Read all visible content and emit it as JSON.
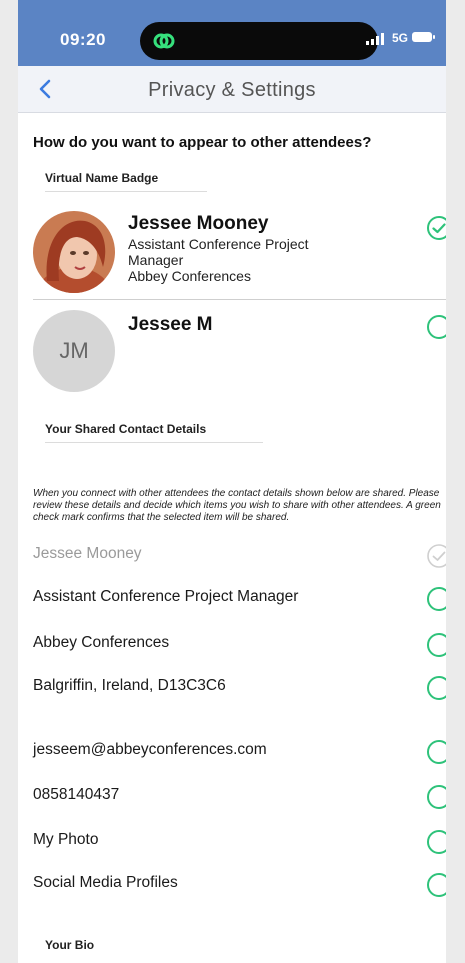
{
  "status_bar": {
    "time": "09:20",
    "network": "5G"
  },
  "nav": {
    "title": "Privacy & Settings",
    "back_icon": "chevron-left-icon"
  },
  "question": "How do you want to appear to other attendees?",
  "name_badge": {
    "heading": "Virtual Name Badge",
    "options": [
      {
        "name": "Jessee Mooney",
        "lines": [
          "Assistant Conference Project",
          "Manager",
          "Abbey Conferences"
        ],
        "selected": true
      },
      {
        "name": "Jessee M",
        "initials": "JM",
        "selected": false
      }
    ]
  },
  "shared_contact": {
    "heading": "Your Shared Contact Details",
    "intro": "When you connect with other attendees the contact details shown below are shared. Please review these details and decide which items you wish to share with other attendees. A green check mark confirms that the selected item will be shared.",
    "items": [
      {
        "label": "Jessee Mooney",
        "state": "locked"
      },
      {
        "label": "Assistant Conference Project Manager",
        "state": "off"
      },
      {
        "label": "Abbey Conferences",
        "state": "off"
      },
      {
        "label": "Balgriffin, Ireland, D13C3C6",
        "state": "off"
      },
      {
        "label": "jesseem@abbeyconferences.com",
        "state": "off"
      },
      {
        "label": "0858140437",
        "state": "off"
      },
      {
        "label": "My Photo",
        "state": "off"
      },
      {
        "label": "Social Media Profiles",
        "state": "off"
      }
    ]
  },
  "bio": {
    "heading": "Your Bio"
  },
  "colors": {
    "accent_green": "#2ec27a",
    "status_bar": "#5b84c4",
    "nav_back": "#3b7be0"
  }
}
